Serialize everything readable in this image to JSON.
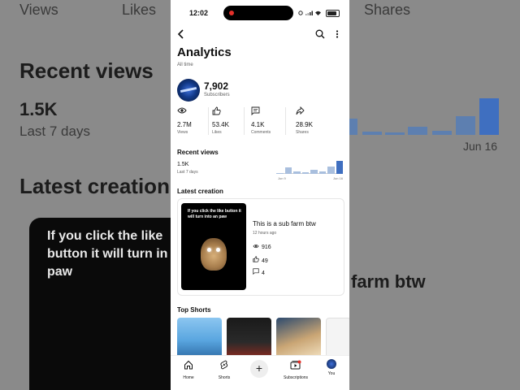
{
  "background": {
    "top_labels": [
      "Views",
      "Likes",
      "Shares"
    ],
    "recent_views_title": "Recent views",
    "recent_views_value": "1.5K",
    "recent_views_period": "Last 7 days",
    "latest_creation_title": "Latest creation",
    "card_text": "If you click the like button it will turn in paw",
    "video_title_partial": "farm btw",
    "chart_label": "Jun 16"
  },
  "status": {
    "time": "12:02"
  },
  "header": {
    "back_icon": "back-arrow-icon",
    "search_icon": "search-icon",
    "more_icon": "more-vertical-icon"
  },
  "page": {
    "title": "Analytics",
    "subtitle": "All time"
  },
  "channel": {
    "subscribers_value": "7,902",
    "subscribers_label": "Subscribers"
  },
  "stats": [
    {
      "icon": "eye-icon",
      "value": "2.7M",
      "label": "Views"
    },
    {
      "icon": "thumbs-up-icon",
      "value": "53.4K",
      "label": "Likes"
    },
    {
      "icon": "comment-icon",
      "value": "4.1K",
      "label": "Comments"
    },
    {
      "icon": "share-icon",
      "value": "28.9K",
      "label": "Shares"
    }
  ],
  "recent_views": {
    "title": "Recent views",
    "value": "1.5K",
    "period": "Last 7 days",
    "start_label": "Jun 9",
    "end_label": "Jun 16"
  },
  "chart_data": {
    "type": "bar",
    "categories": [
      "Jun 9",
      "",
      "",
      "",
      "",
      "",
      "",
      "Jun 16"
    ],
    "values": [
      30,
      220,
      80,
      60,
      120,
      75,
      240,
      420
    ],
    "highlight_index": 7,
    "title": "",
    "xlabel": "",
    "ylabel": ""
  },
  "latest_creation": {
    "title": "Latest creation",
    "thumbnail_text": "If you click the like button it will turn into an paw",
    "video_title": "This is a sub farm btw",
    "time_ago": "12 hours ago",
    "views": "916",
    "likes": "49",
    "comments": "4"
  },
  "top_shorts": {
    "title": "Top Shorts"
  },
  "nav": {
    "home": "Home",
    "shorts": "Shorts",
    "create": "+",
    "subscriptions": "Subscriptions",
    "you": "You"
  },
  "colors": {
    "accent_bar": "#3f6fc0",
    "bar": "#a9bfde",
    "record_dot": "#e4302a"
  }
}
